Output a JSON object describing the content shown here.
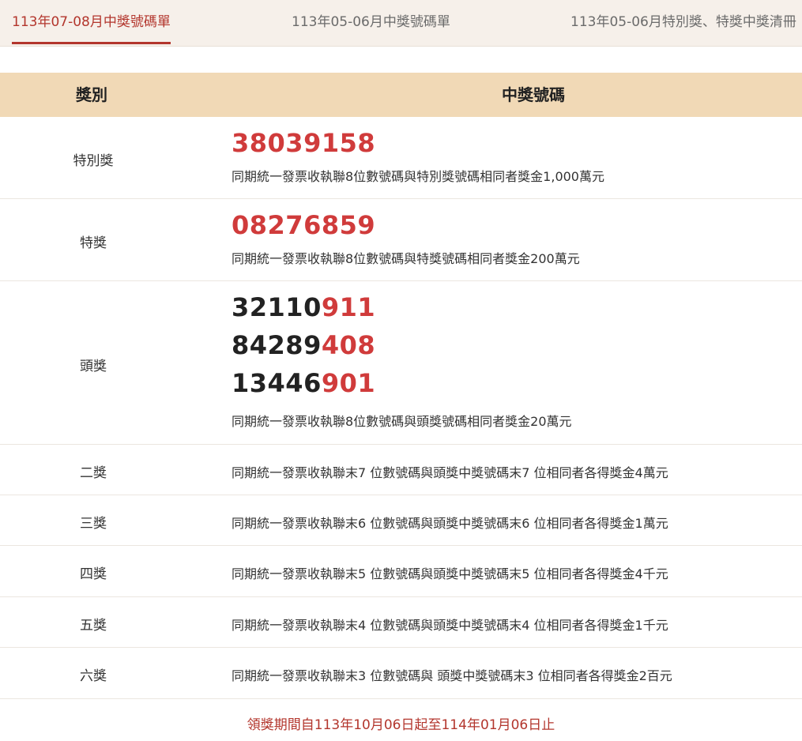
{
  "tabs": [
    {
      "label": "113年07-08月中獎號碼單",
      "active": true
    },
    {
      "label": "113年05-06月中獎號碼單",
      "active": false
    },
    {
      "label": "113年05-06月特別獎、特獎中獎清冊",
      "active": false
    }
  ],
  "table": {
    "header_category": "獎別",
    "header_numbers": "中獎號碼"
  },
  "prizes": {
    "special": {
      "name": "特別獎",
      "number": "38039158",
      "desc": "同期統一發票收執聯8位數號碼與特別獎號碼相同者獎金1,000萬元"
    },
    "grand": {
      "name": "特獎",
      "number": "08276859",
      "desc": "同期統一發票收執聯8位數號碼與特獎號碼相同者獎金200萬元"
    },
    "first": {
      "name": "頭獎",
      "numbers": [
        {
          "head": "32110",
          "tail": "911"
        },
        {
          "head": "84289",
          "tail": "408"
        },
        {
          "head": "13446",
          "tail": "901"
        }
      ],
      "desc": "同期統一發票收執聯8位數號碼與頭獎號碼相同者獎金20萬元"
    },
    "second": {
      "name": "二獎",
      "desc": "同期統一發票收執聯末7 位數號碼與頭獎中獎號碼末7 位相同者各得獎金4萬元"
    },
    "third": {
      "name": "三獎",
      "desc": "同期統一發票收執聯末6 位數號碼與頭獎中獎號碼末6 位相同者各得獎金1萬元"
    },
    "fourth": {
      "name": "四獎",
      "desc": "同期統一發票收執聯末5 位數號碼與頭獎中獎號碼末5 位相同者各得獎金4千元"
    },
    "fifth": {
      "name": "五獎",
      "desc": "同期統一發票收執聯末4 位數號碼與頭獎中獎號碼末4 位相同者各得獎金1千元"
    },
    "sixth": {
      "name": "六獎",
      "desc": "同期統一發票收執聯末3 位數號碼與 頭獎中獎號碼末3 位相同者各得獎金2百元"
    }
  },
  "footer": {
    "claim_period": "領獎期間自113年10月06日起至114年01月06日止"
  },
  "colors": {
    "accent_red": "#d03b3b",
    "tab_active": "#b3362d",
    "header_bg": "#f1d9b6",
    "tabbar_bg": "#f6f0ea"
  }
}
